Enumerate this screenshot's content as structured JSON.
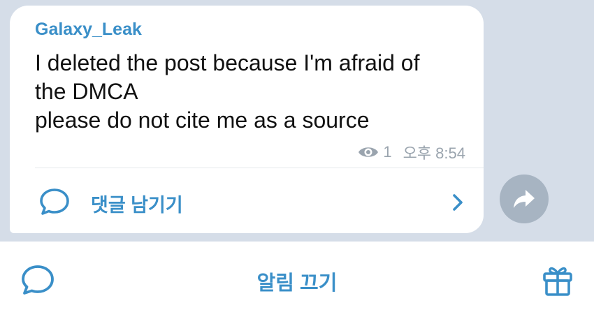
{
  "post": {
    "sender": "Galaxy_Leak",
    "message_lines": [
      "I deleted the post because I'm afraid of",
      "the DMCA",
      "please do not cite me as a source"
    ],
    "views": "1",
    "time": "오후 8:54"
  },
  "comments": {
    "label": "댓글 남기기",
    "icon": "comment-icon"
  },
  "share": {
    "icon": "share-arrow-icon"
  },
  "bottom_bar": {
    "mute_label": "알림 끄기",
    "left_icon": "comment-icon",
    "right_icon": "gift-icon"
  },
  "colors": {
    "accent": "#3a8fc8",
    "chat_background": "#d5dde8",
    "meta_gray": "#9aa4ae",
    "share_button": "#a7b4c2"
  }
}
